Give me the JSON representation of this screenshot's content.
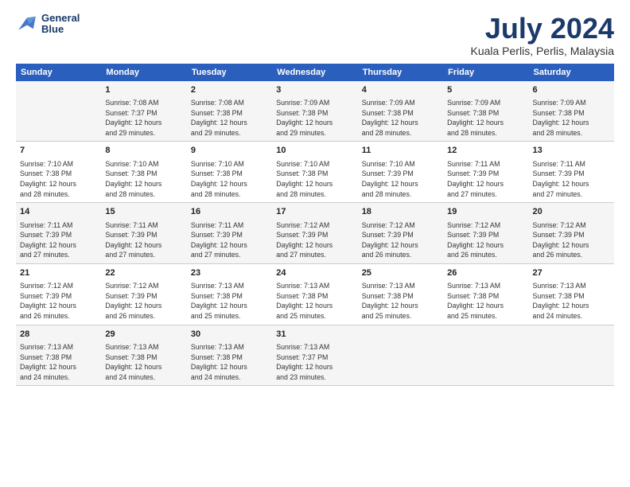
{
  "header": {
    "logo_line1": "General",
    "logo_line2": "Blue",
    "month_title": "July 2024",
    "location": "Kuala Perlis, Perlis, Malaysia"
  },
  "weekdays": [
    "Sunday",
    "Monday",
    "Tuesday",
    "Wednesday",
    "Thursday",
    "Friday",
    "Saturday"
  ],
  "weeks": [
    [
      {
        "day": "",
        "info": ""
      },
      {
        "day": "1",
        "info": "Sunrise: 7:08 AM\nSunset: 7:37 PM\nDaylight: 12 hours\nand 29 minutes."
      },
      {
        "day": "2",
        "info": "Sunrise: 7:08 AM\nSunset: 7:38 PM\nDaylight: 12 hours\nand 29 minutes."
      },
      {
        "day": "3",
        "info": "Sunrise: 7:09 AM\nSunset: 7:38 PM\nDaylight: 12 hours\nand 29 minutes."
      },
      {
        "day": "4",
        "info": "Sunrise: 7:09 AM\nSunset: 7:38 PM\nDaylight: 12 hours\nand 28 minutes."
      },
      {
        "day": "5",
        "info": "Sunrise: 7:09 AM\nSunset: 7:38 PM\nDaylight: 12 hours\nand 28 minutes."
      },
      {
        "day": "6",
        "info": "Sunrise: 7:09 AM\nSunset: 7:38 PM\nDaylight: 12 hours\nand 28 minutes."
      }
    ],
    [
      {
        "day": "7",
        "info": "Sunrise: 7:10 AM\nSunset: 7:38 PM\nDaylight: 12 hours\nand 28 minutes."
      },
      {
        "day": "8",
        "info": "Sunrise: 7:10 AM\nSunset: 7:38 PM\nDaylight: 12 hours\nand 28 minutes."
      },
      {
        "day": "9",
        "info": "Sunrise: 7:10 AM\nSunset: 7:38 PM\nDaylight: 12 hours\nand 28 minutes."
      },
      {
        "day": "10",
        "info": "Sunrise: 7:10 AM\nSunset: 7:38 PM\nDaylight: 12 hours\nand 28 minutes."
      },
      {
        "day": "11",
        "info": "Sunrise: 7:10 AM\nSunset: 7:39 PM\nDaylight: 12 hours\nand 28 minutes."
      },
      {
        "day": "12",
        "info": "Sunrise: 7:11 AM\nSunset: 7:39 PM\nDaylight: 12 hours\nand 27 minutes."
      },
      {
        "day": "13",
        "info": "Sunrise: 7:11 AM\nSunset: 7:39 PM\nDaylight: 12 hours\nand 27 minutes."
      }
    ],
    [
      {
        "day": "14",
        "info": "Sunrise: 7:11 AM\nSunset: 7:39 PM\nDaylight: 12 hours\nand 27 minutes."
      },
      {
        "day": "15",
        "info": "Sunrise: 7:11 AM\nSunset: 7:39 PM\nDaylight: 12 hours\nand 27 minutes."
      },
      {
        "day": "16",
        "info": "Sunrise: 7:11 AM\nSunset: 7:39 PM\nDaylight: 12 hours\nand 27 minutes."
      },
      {
        "day": "17",
        "info": "Sunrise: 7:12 AM\nSunset: 7:39 PM\nDaylight: 12 hours\nand 27 minutes."
      },
      {
        "day": "18",
        "info": "Sunrise: 7:12 AM\nSunset: 7:39 PM\nDaylight: 12 hours\nand 26 minutes."
      },
      {
        "day": "19",
        "info": "Sunrise: 7:12 AM\nSunset: 7:39 PM\nDaylight: 12 hours\nand 26 minutes."
      },
      {
        "day": "20",
        "info": "Sunrise: 7:12 AM\nSunset: 7:39 PM\nDaylight: 12 hours\nand 26 minutes."
      }
    ],
    [
      {
        "day": "21",
        "info": "Sunrise: 7:12 AM\nSunset: 7:39 PM\nDaylight: 12 hours\nand 26 minutes."
      },
      {
        "day": "22",
        "info": "Sunrise: 7:12 AM\nSunset: 7:39 PM\nDaylight: 12 hours\nand 26 minutes."
      },
      {
        "day": "23",
        "info": "Sunrise: 7:13 AM\nSunset: 7:38 PM\nDaylight: 12 hours\nand 25 minutes."
      },
      {
        "day": "24",
        "info": "Sunrise: 7:13 AM\nSunset: 7:38 PM\nDaylight: 12 hours\nand 25 minutes."
      },
      {
        "day": "25",
        "info": "Sunrise: 7:13 AM\nSunset: 7:38 PM\nDaylight: 12 hours\nand 25 minutes."
      },
      {
        "day": "26",
        "info": "Sunrise: 7:13 AM\nSunset: 7:38 PM\nDaylight: 12 hours\nand 25 minutes."
      },
      {
        "day": "27",
        "info": "Sunrise: 7:13 AM\nSunset: 7:38 PM\nDaylight: 12 hours\nand 24 minutes."
      }
    ],
    [
      {
        "day": "28",
        "info": "Sunrise: 7:13 AM\nSunset: 7:38 PM\nDaylight: 12 hours\nand 24 minutes."
      },
      {
        "day": "29",
        "info": "Sunrise: 7:13 AM\nSunset: 7:38 PM\nDaylight: 12 hours\nand 24 minutes."
      },
      {
        "day": "30",
        "info": "Sunrise: 7:13 AM\nSunset: 7:38 PM\nDaylight: 12 hours\nand 24 minutes."
      },
      {
        "day": "31",
        "info": "Sunrise: 7:13 AM\nSunset: 7:37 PM\nDaylight: 12 hours\nand 23 minutes."
      },
      {
        "day": "",
        "info": ""
      },
      {
        "day": "",
        "info": ""
      },
      {
        "day": "",
        "info": ""
      }
    ]
  ]
}
